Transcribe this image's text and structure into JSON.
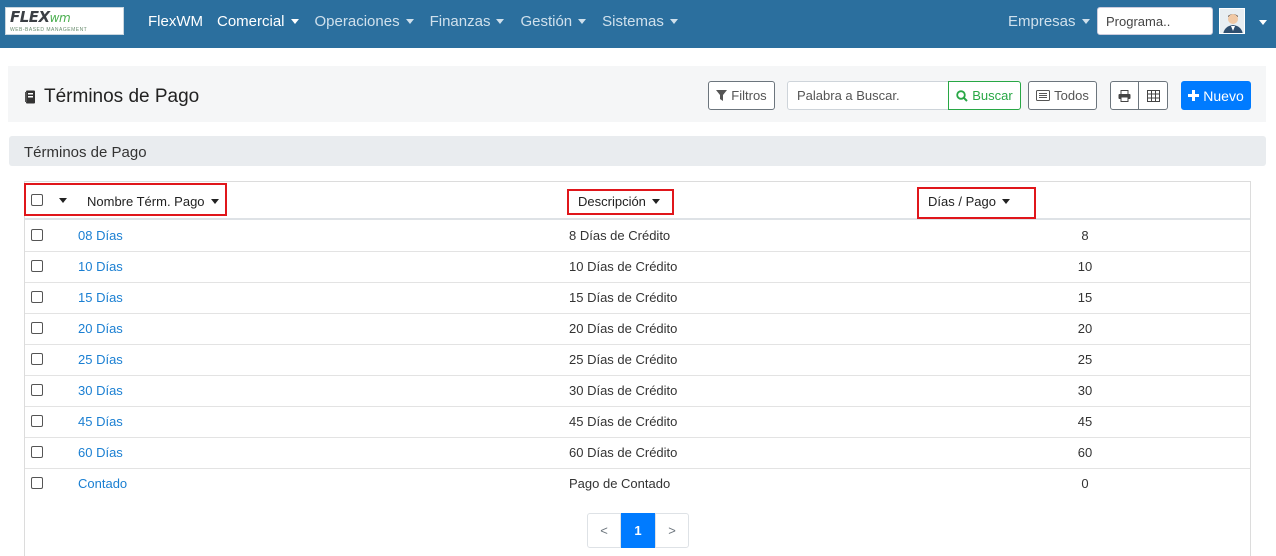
{
  "navbar": {
    "logo_text": "FLEX",
    "logo_suffix": "wm",
    "logo_tagline": "WEB-BASED MANAGEMENT",
    "brand": "FlexWM",
    "menu": [
      {
        "label": "Comercial",
        "active": true
      },
      {
        "label": "Operaciones",
        "active": false
      },
      {
        "label": "Finanzas",
        "active": false
      },
      {
        "label": "Gestión",
        "active": false
      },
      {
        "label": "Sistemas",
        "active": false
      }
    ],
    "empresas": "Empresas",
    "search_placeholder": "Programa..",
    "avatar_icon": "user-avatar-icon"
  },
  "header": {
    "title": "Términos de Pago",
    "filters_label": "Filtros",
    "search_placeholder": "Palabra a Buscar.",
    "search_label": "Buscar",
    "todos_label": "Todos",
    "print_icon": "print-icon",
    "grid_icon": "table-icon",
    "new_label": "Nuevo"
  },
  "section": {
    "title": "Términos de Pago"
  },
  "table": {
    "columns": [
      "Nombre Térm. Pago",
      "Descripción",
      "Días / Pago"
    ],
    "rows": [
      {
        "name": "08 Días",
        "description": "8 Días de Crédito",
        "days": "8"
      },
      {
        "name": "10 Días",
        "description": "10 Días de Crédito",
        "days": "10"
      },
      {
        "name": "15 Días",
        "description": "15 Días de Crédito",
        "days": "15"
      },
      {
        "name": "20 Días",
        "description": "20 Días de Crédito",
        "days": "20"
      },
      {
        "name": "25 Días",
        "description": "25 Días de Crédito",
        "days": "25"
      },
      {
        "name": "30 Días",
        "description": "30 Días de Crédito",
        "days": "30"
      },
      {
        "name": "45 Días",
        "description": "45 Días de Crédito",
        "days": "45"
      },
      {
        "name": "60 Días",
        "description": "60 Días de Crédito",
        "days": "60"
      },
      {
        "name": "Contado",
        "description": "Pago de Contado",
        "days": "0"
      }
    ]
  },
  "pagination": {
    "prev": "<",
    "current": "1",
    "next": ">"
  },
  "colors": {
    "navbar": "#2b6f9e",
    "link": "#1a7fd2",
    "primary": "#007bff",
    "success": "#28a745",
    "highlight": "#e0161b"
  }
}
